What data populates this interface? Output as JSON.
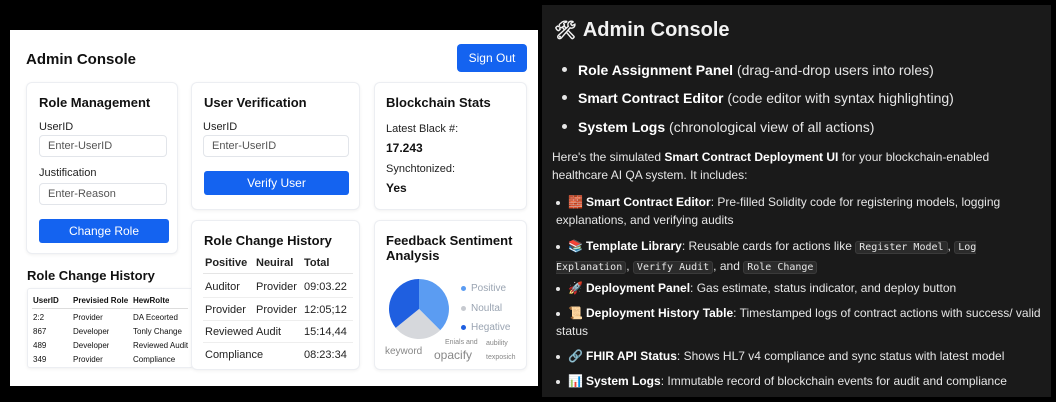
{
  "left": {
    "app_title": "Admin Console",
    "sign_out": "Sign Out",
    "role_management": {
      "title": "Role Management",
      "userid_label": "UserID",
      "userid_placeholder": "Enter-UserID",
      "justification_label": "Justification",
      "justification_placeholder": "Enter-Reason",
      "button": "Change Role"
    },
    "user_verification": {
      "title": "User Verification",
      "userid_label": "UserID",
      "userid_placeholder": "Enter-UserID",
      "button": "Verify User"
    },
    "blockchain_stats": {
      "title": "Blockchain Stats",
      "latest_block_label": "Latest Black #:",
      "latest_block_value": "17.243",
      "sync_label": "Synchtonized:",
      "sync_value": "Yes"
    },
    "rch_small": {
      "title": "Role Change History",
      "headers": [
        "UserID",
        "Previsied Role",
        "HewRolte"
      ],
      "rows": [
        [
          "2:2",
          "Provider",
          "DA Eceorted"
        ],
        [
          "867",
          "Developer",
          "Tonly Change"
        ],
        [
          "489",
          "Developer",
          "Reviewed Audit"
        ],
        [
          "349",
          "Provider",
          "Compliance"
        ]
      ]
    },
    "rch_mid": {
      "title": "Role Change History",
      "headers": [
        "Positive",
        "Neuiral",
        "Total"
      ],
      "rows": [
        [
          "Auditor",
          "Provider",
          "09:03.22"
        ],
        [
          "Provider",
          "Provider",
          "12:05;12"
        ],
        [
          "Reviewed",
          "Audit",
          "15:14,44"
        ],
        [
          "Compliance",
          "",
          "08:23:34"
        ]
      ]
    },
    "feedback": {
      "title": "Feedback Sentiment Analysis",
      "legend": [
        "Positive",
        "Noultal",
        "Hegative"
      ],
      "colors": {
        "positive": "#5b9cf2",
        "neutral": "#d6d8dc",
        "negative": "#1f5fe0"
      },
      "words": [
        "keyword",
        "Enials and",
        "opacify",
        "aubility",
        "texposich"
      ]
    }
  },
  "right": {
    "title_icon": "hammer-wrench-icon",
    "title": "Admin Console",
    "features": [
      {
        "bold": "Role Assignment Panel",
        "text": " (drag-and-drop users into roles)"
      },
      {
        "bold": "Smart Contract Editor",
        "text": " (code editor with syntax highlighting)"
      },
      {
        "bold": "System Logs",
        "text": " (chronological view of all actions)"
      }
    ],
    "para_pre": "Here's the simulated ",
    "para_bold": "Smart Contract Deployment UI",
    "para_post": " for your blockchain-enabled healthcare AI QA system. It includes:",
    "items": [
      {
        "icon": "brick-icon",
        "bold": "Smart Contract Editor",
        "text": ": Pre-filled Solidity code for registering models, logging explanations, and verifying audits"
      },
      {
        "icon": "books-icon",
        "bold": "Template Library",
        "text": ": Reusable cards for actions like "
      },
      {
        "icon": "rocket-icon",
        "bold": "Deployment Panel",
        "text": ": Gas estimate, status indicator, and deploy button"
      },
      {
        "icon": "scroll-icon",
        "bold": "Deployment History Table",
        "text": ": Timestamped logs of contract actions with success/ valid status"
      },
      {
        "icon": "link-icon",
        "bold": "FHIR API Status",
        "text": ": Shows HL7 v4 compliance and sync status with latest model"
      },
      {
        "icon": "bar-chart-icon",
        "bold": "System Logs",
        "text": ": Immutable record of blockchain events for audit and compliance"
      }
    ],
    "codes": [
      "Register Model",
      "Log Explanation",
      "Verify Audit",
      "Role Change"
    ],
    "code_sep": ",",
    "code_and": ", and",
    "emoji": {
      "title": "🛠",
      "brick": "🧱",
      "books": "📚",
      "rocket": "🚀",
      "scroll": "📜",
      "link": "🔗",
      "chart": "📊"
    }
  }
}
